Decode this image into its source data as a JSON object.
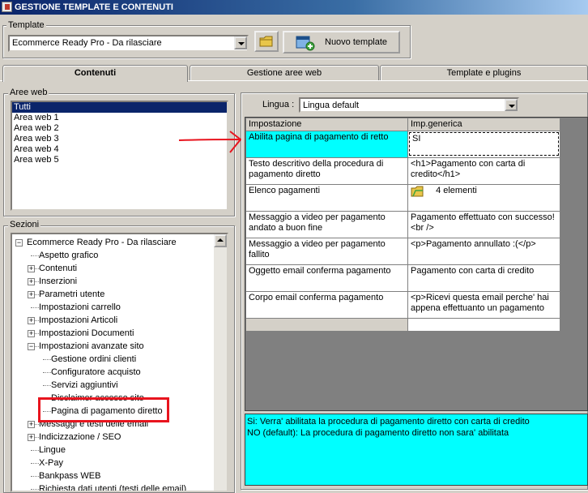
{
  "window": {
    "title": "GESTIONE TEMPLATE E CONTENUTI"
  },
  "template": {
    "group_label": "Template",
    "selected": "Ecommerce Ready Pro - Da rilasciare",
    "new_button": "Nuovo template"
  },
  "tabs": [
    {
      "label": "Contenuti"
    },
    {
      "label": "Gestione aree web"
    },
    {
      "label": "Template e plugins"
    }
  ],
  "aree_web": {
    "label": "Aree web",
    "items": [
      "Tutti",
      "Area web 1",
      "Area web 2",
      "Area web 3",
      "Area web 4",
      "Area web 5"
    ]
  },
  "sezioni": {
    "label": "Sezioni",
    "tree": [
      {
        "label": "Ecommerce Ready Pro - Da rilasciare",
        "level": 0,
        "expander": "minus"
      },
      {
        "label": "Aspetto grafico",
        "level": 1,
        "expander": "none"
      },
      {
        "label": "Contenuti",
        "level": 1,
        "expander": "plus"
      },
      {
        "label": "Inserzioni",
        "level": 1,
        "expander": "plus"
      },
      {
        "label": "Parametri utente",
        "level": 1,
        "expander": "plus"
      },
      {
        "label": "Impostazioni carrello",
        "level": 1,
        "expander": "none"
      },
      {
        "label": "Impostazioni Articoli",
        "level": 1,
        "expander": "plus"
      },
      {
        "label": "Impostazioni Documenti",
        "level": 1,
        "expander": "plus"
      },
      {
        "label": "Impostazioni avanzate sito",
        "level": 1,
        "expander": "minus"
      },
      {
        "label": "Gestione ordini clienti",
        "level": 2,
        "expander": "none"
      },
      {
        "label": "Configuratore acquisto",
        "level": 2,
        "expander": "none"
      },
      {
        "label": "Servizi aggiuntivi",
        "level": 2,
        "expander": "none"
      },
      {
        "label": "Disclaimer accesso sito",
        "level": 2,
        "expander": "none"
      },
      {
        "label": "Pagina di pagamento diretto",
        "level": 2,
        "expander": "none",
        "highlighted": true
      },
      {
        "label": "Messaggi e testi delle email",
        "level": 1,
        "expander": "plus"
      },
      {
        "label": "Indicizzazione / SEO",
        "level": 1,
        "expander": "plus"
      },
      {
        "label": "Lingue",
        "level": 1,
        "expander": "none"
      },
      {
        "label": "X-Pay",
        "level": 1,
        "expander": "none"
      },
      {
        "label": "Bankpass WEB",
        "level": 1,
        "expander": "none"
      },
      {
        "label": "Richiesta dati utenti (testi delle email)",
        "level": 1,
        "expander": "none"
      }
    ]
  },
  "lingua": {
    "label": "Lingua :",
    "selected": "Lingua default"
  },
  "grid": {
    "headers": [
      "Impostazione",
      "Imp.generica"
    ],
    "rows": [
      {
        "setting": "Abilita pagina di pagamento di retto",
        "value": "SI",
        "selected": true
      },
      {
        "setting": "Testo descritivo della procedura di pagamento diretto",
        "value": "<h1>Pagamento con carta di credito</h1>"
      },
      {
        "setting": "Elenco pagamenti",
        "value": "4 elementi",
        "icon": "folder-icon"
      },
      {
        "setting": "Messaggio a video per pagamento andato a buon fine",
        "value": "Pagamento effettuato con successo!<br />"
      },
      {
        "setting": "Messaggio a video per pagamento fallito",
        "value": "<p>Pagamento annullato :(</p>"
      },
      {
        "setting": "Oggetto email conferma pagamento",
        "value": "Pagamento con carta di credito"
      },
      {
        "setting": "Corpo email conferma pagamento",
        "value": "<p>Ricevi questa email perche' hai appena effettuanto un pagamento"
      },
      {
        "setting": "",
        "value": ""
      }
    ]
  },
  "description": {
    "lines": [
      "Si: Verra' abilitata la procedura di pagamento diretto con carta di credito",
      "NO (default): La procedura di pagamento diretto non sara' abilitata"
    ]
  },
  "colors": {
    "selection_cyan": "#00ffff",
    "annotation_red": "#e8141e",
    "titlebar": "#0a246a"
  }
}
